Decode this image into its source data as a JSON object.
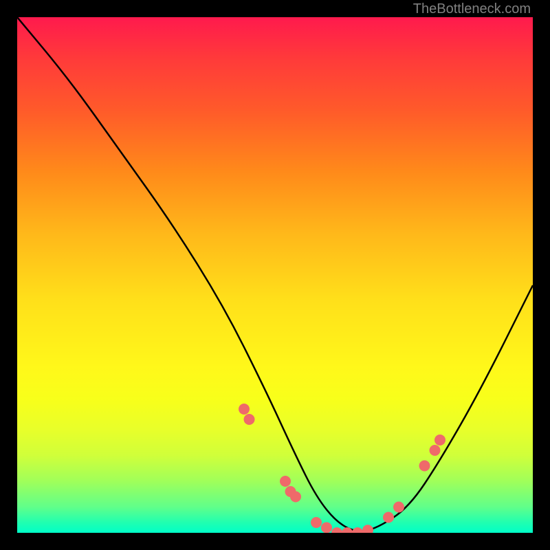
{
  "watermark": "TheBottleneck.com",
  "chart_data": {
    "type": "line",
    "title": "",
    "xlabel": "",
    "ylabel": "",
    "xlim": [
      0,
      100
    ],
    "ylim": [
      0,
      100
    ],
    "grid": false,
    "series": [
      {
        "name": "curve",
        "x": [
          0,
          10,
          20,
          30,
          40,
          48,
          54,
          58,
          62,
          66,
          70,
          76,
          82,
          90,
          100
        ],
        "y": [
          100,
          88,
          74,
          60,
          44,
          28,
          15,
          7,
          2,
          0,
          1,
          5,
          14,
          28,
          48
        ]
      }
    ],
    "markers": [
      {
        "x": 44,
        "y": 24
      },
      {
        "x": 45,
        "y": 22
      },
      {
        "x": 52,
        "y": 10
      },
      {
        "x": 53,
        "y": 8
      },
      {
        "x": 54,
        "y": 7
      },
      {
        "x": 58,
        "y": 2
      },
      {
        "x": 60,
        "y": 1
      },
      {
        "x": 62,
        "y": 0
      },
      {
        "x": 64,
        "y": 0
      },
      {
        "x": 66,
        "y": 0
      },
      {
        "x": 68,
        "y": 0.5
      },
      {
        "x": 72,
        "y": 3
      },
      {
        "x": 74,
        "y": 5
      },
      {
        "x": 79,
        "y": 13
      },
      {
        "x": 81,
        "y": 16
      },
      {
        "x": 82,
        "y": 18
      }
    ],
    "marker_color": "#ef6a6a",
    "background_gradient": [
      "#ff1a4d",
      "#ffe01a",
      "#00ffc8"
    ]
  }
}
